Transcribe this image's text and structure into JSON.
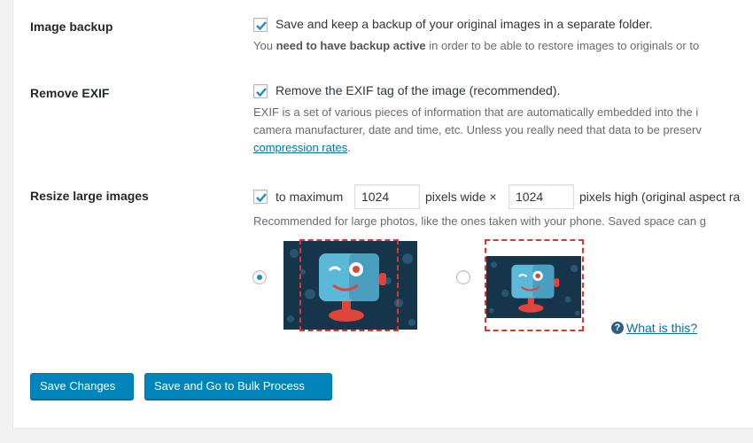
{
  "image_backup": {
    "label": "Image backup",
    "checked": true,
    "checkbox_text": "Save and keep a backup of your original images in a separate folder.",
    "desc_prefix": "You ",
    "desc_bold": "need to have backup active",
    "desc_suffix": " in order to be able to restore images to originals or to"
  },
  "remove_exif": {
    "label": "Remove EXIF",
    "checked": true,
    "checkbox_text": "Remove the EXIF tag of the image (recommended).",
    "desc_line1": "EXIF is a set of various pieces of information that are automatically embedded into the i",
    "desc_line2": "camera manufacturer, date and time, etc. Unless you really need that data to be preserv",
    "desc_link": "compression rates",
    "desc_link_suffix": "."
  },
  "resize": {
    "label": "Resize large images",
    "checked": true,
    "prefix": "to maximum",
    "width_value": "1024",
    "width_suffix": "pixels wide ×",
    "height_value": "1024",
    "height_suffix": "pixels high (original aspect ra",
    "desc": "Recommended for large photos, like the ones taken with your phone. Saved space can g",
    "option_selected": 0,
    "help_link": "What is this?"
  },
  "buttons": {
    "save": "Save Changes",
    "save_bulk": "Save and Go to Bulk Process"
  },
  "colors": {
    "primary": "#0085ba",
    "link": "#0073aa",
    "dash": "#d9392f",
    "robot": "#5bb8d6"
  }
}
